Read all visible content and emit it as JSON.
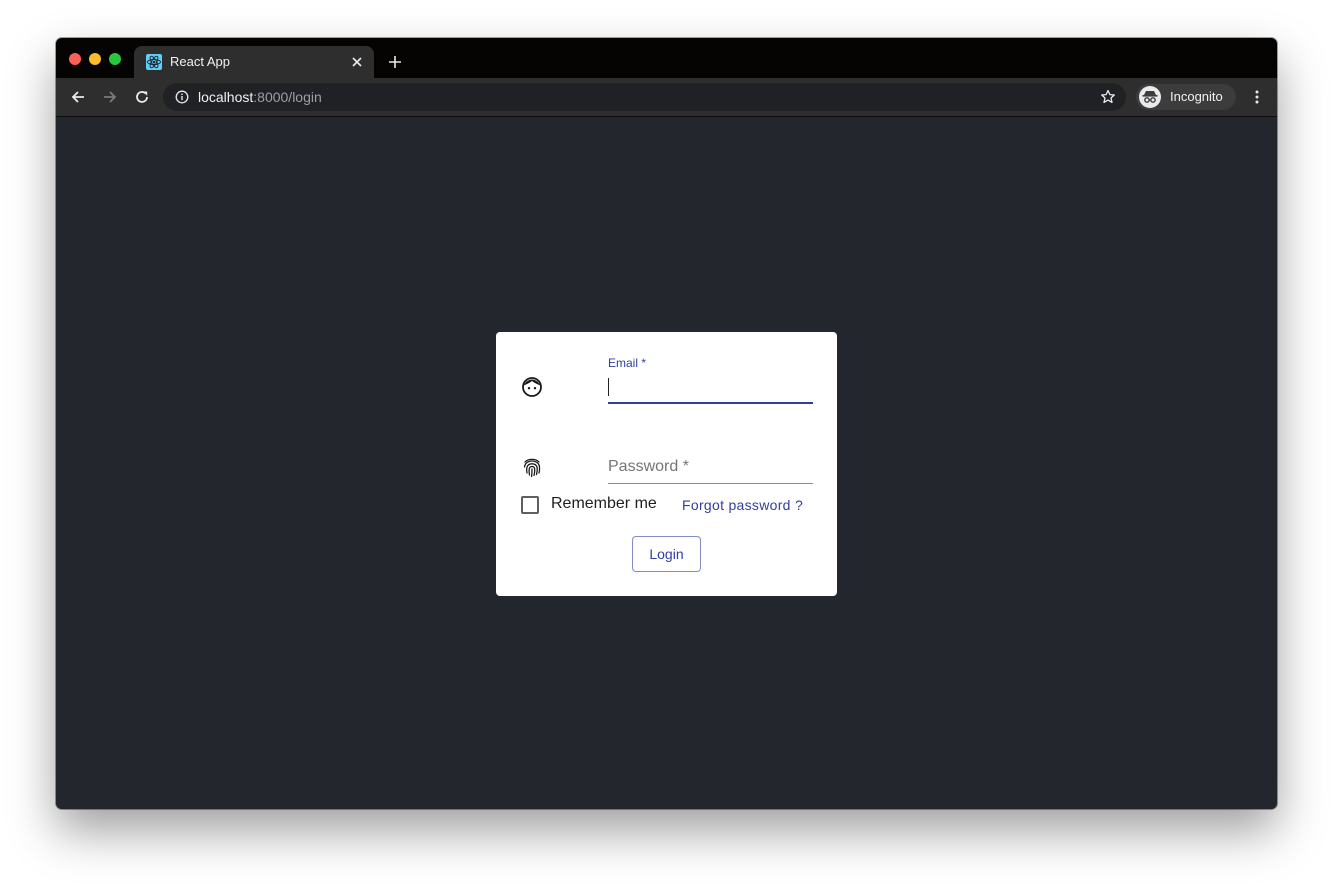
{
  "browser": {
    "tab": {
      "title": "React App",
      "favicon": "react-icon"
    },
    "address_bar": {
      "host": "localhost",
      "rest": ":8000/login"
    },
    "profile_label": "Incognito",
    "colors": {
      "tabstrip": "#060403",
      "toolbar": "#2e2e2e",
      "omnibox": "#202124"
    }
  },
  "login": {
    "email": {
      "label": "Email",
      "required_mark": " *",
      "value": "",
      "icon": "face-icon"
    },
    "password": {
      "label": "Password",
      "required_mark": " *",
      "value": "",
      "icon": "fingerprint-icon"
    },
    "remember_me": {
      "label": "Remember me",
      "checked": false
    },
    "forgot_password": "Forgot password ?",
    "submit_label": "Login",
    "colors": {
      "page_background": "#23262d",
      "accent": "#303f9f",
      "card": "#ffffff"
    }
  }
}
